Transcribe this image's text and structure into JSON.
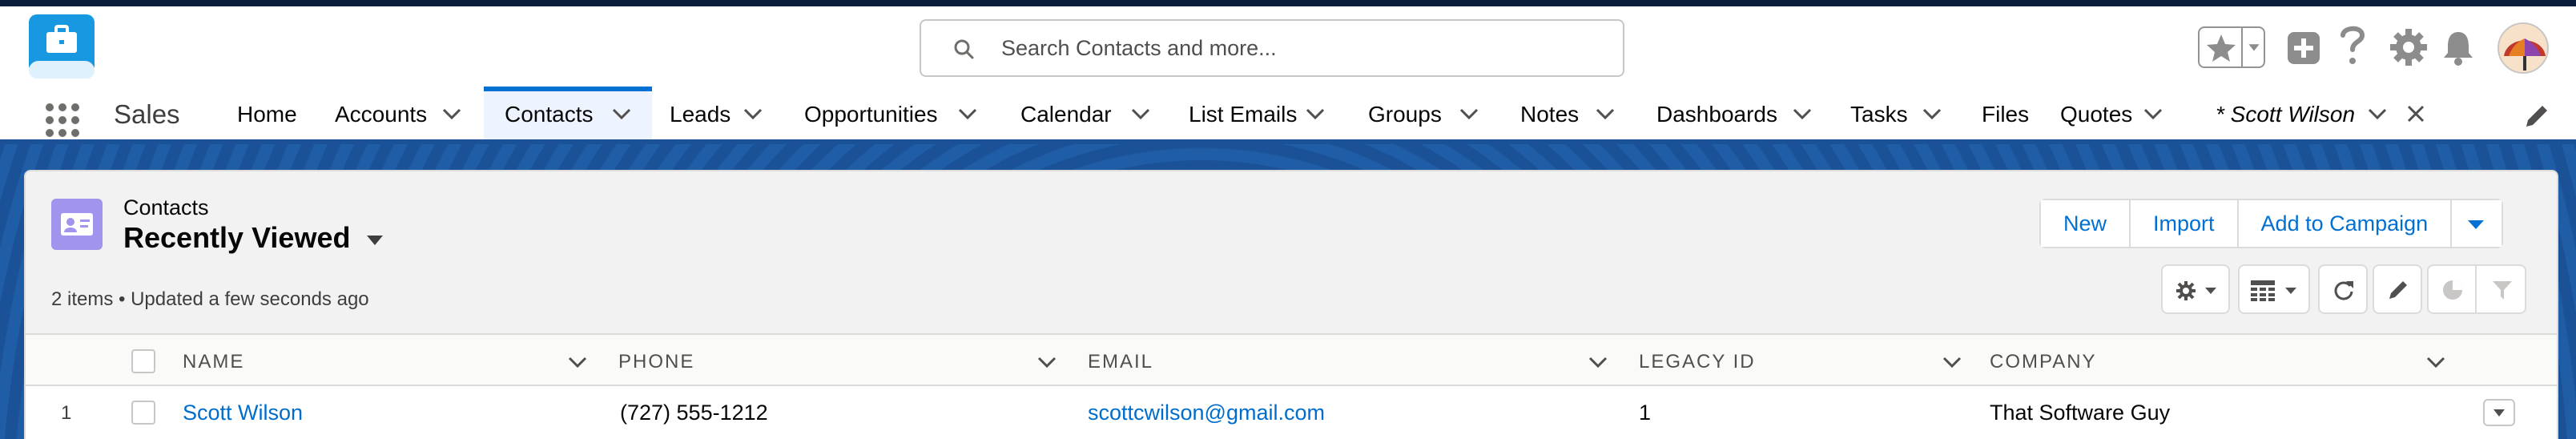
{
  "header": {
    "search": {
      "placeholder": "Search Contacts and more..."
    }
  },
  "nav": {
    "app_name": "Sales",
    "tabs": [
      {
        "label": "Home"
      },
      {
        "label": "Accounts"
      },
      {
        "label": "Contacts"
      },
      {
        "label": "Leads"
      },
      {
        "label": "Opportunities"
      },
      {
        "label": "Calendar"
      },
      {
        "label": "List Emails"
      },
      {
        "label": "Groups"
      },
      {
        "label": "Notes"
      },
      {
        "label": "Dashboards"
      },
      {
        "label": "Tasks"
      },
      {
        "label": "Files"
      },
      {
        "label": "Quotes"
      },
      {
        "label": "* Scott Wilson"
      }
    ],
    "active_tab": "Contacts"
  },
  "list_view": {
    "object_label": "Contacts",
    "title": "Recently Viewed",
    "meta": "2 items • Updated a few seconds ago",
    "buttons": {
      "new": "New",
      "import": "Import",
      "add_to_campaign": "Add to Campaign"
    }
  },
  "table": {
    "columns": [
      "NAME",
      "PHONE",
      "EMAIL",
      "LEGACY ID",
      "COMPANY"
    ],
    "rows": [
      {
        "num": "1",
        "name": "Scott Wilson",
        "phone": "(727) 555-1212",
        "email": "scottcwilson@gmail.com",
        "legacy_id": "1",
        "company": "That Software Guy"
      }
    ]
  },
  "colors": {
    "brand_blue": "#1b5297",
    "link": "#006dcc",
    "contacts_icon": "#a094ed",
    "active_tab_border": "#0070d2"
  }
}
